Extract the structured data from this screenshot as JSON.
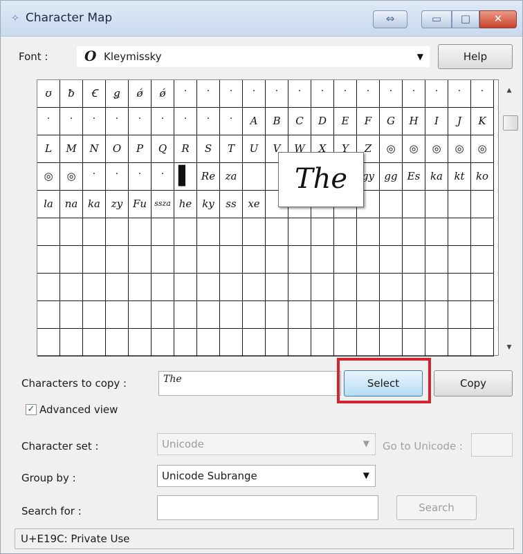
{
  "window": {
    "title": "Character Map",
    "icon": "character-map-icon",
    "controls": {
      "swap": "⇔",
      "minimize": "▭",
      "maximize": "□",
      "close": "✕"
    }
  },
  "font_row": {
    "label": "Font :",
    "selected_glyph": "O",
    "selected_font": "Kleymissky",
    "help_label": "Help"
  },
  "grid": {
    "rows": [
      [
        "ʊ",
        "ƀ",
        "Ꞓ",
        "ǥ",
        "ǿ",
        "ǿ",
        "·",
        "·",
        "·",
        "·",
        "·",
        "·",
        "·",
        "·",
        "·",
        "·",
        "·",
        "·",
        "·",
        "·"
      ],
      [
        "·",
        "·",
        "·",
        "·",
        "·",
        "·",
        "·",
        "·",
        "·",
        "A",
        "B",
        "C",
        "D",
        "E",
        "F",
        "G",
        "H",
        "I",
        "J",
        "K"
      ],
      [
        "L",
        "M",
        "N",
        "O",
        "P",
        "Q",
        "R",
        "S",
        "T",
        "U",
        "V",
        "W",
        "X",
        "Y",
        "Z",
        "◎",
        "◎",
        "◎",
        "◎",
        "◎"
      ],
      [
        "◎",
        "◎",
        "·",
        "·",
        "·",
        "·",
        "▌",
        "Re",
        "za",
        "",
        "",
        "",
        "",
        "",
        "gy",
        "gg",
        "Es",
        "ka",
        "kt",
        "ko"
      ],
      [
        "la",
        "na",
        "ka",
        "zy",
        "Fu",
        "ssza",
        "he",
        "ky",
        "ss",
        "xe",
        "",
        "",
        "",
        "",
        "",
        "",
        "",
        "",
        "",
        ""
      ],
      [
        "",
        "",
        "",
        "",
        "",
        "",
        "",
        "",
        "",
        "",
        "",
        "",
        "",
        "",
        "",
        "",
        "",
        "",
        "",
        ""
      ],
      [
        "",
        "",
        "",
        "",
        "",
        "",
        "",
        "",
        "",
        "",
        "",
        "",
        "",
        "",
        "",
        "",
        "",
        "",
        "",
        ""
      ],
      [
        "",
        "",
        "",
        "",
        "",
        "",
        "",
        "",
        "",
        "",
        "",
        "",
        "",
        "",
        "",
        "",
        "",
        "",
        "",
        ""
      ],
      [
        "",
        "",
        "",
        "",
        "",
        "",
        "",
        "",
        "",
        "",
        "",
        "",
        "",
        "",
        "",
        "",
        "",
        "",
        "",
        ""
      ],
      [
        "",
        "",
        "",
        "",
        "",
        "",
        "",
        "",
        "",
        "",
        "",
        "",
        "",
        "",
        "",
        "",
        "",
        "",
        "",
        ""
      ]
    ],
    "zoom_preview": "The"
  },
  "copy_row": {
    "label": "Characters to copy :",
    "value": "The",
    "select_label": "Select",
    "copy_label": "Copy"
  },
  "advanced_view": {
    "label": "Advanced view",
    "checked": true,
    "mark": "✓"
  },
  "character_set": {
    "label": "Character set :",
    "value": "Unicode",
    "goto_label": "Go to Unicode :",
    "goto_value": ""
  },
  "group_by": {
    "label": "Group by :",
    "value": "Unicode Subrange"
  },
  "search": {
    "label": "Search for :",
    "value": "",
    "button_label": "Search"
  },
  "status": "U+E19C: Private Use",
  "colors": {
    "highlight": "#d2232e",
    "select_button": "#b7dcf4",
    "titlebar": "#c9daee"
  }
}
